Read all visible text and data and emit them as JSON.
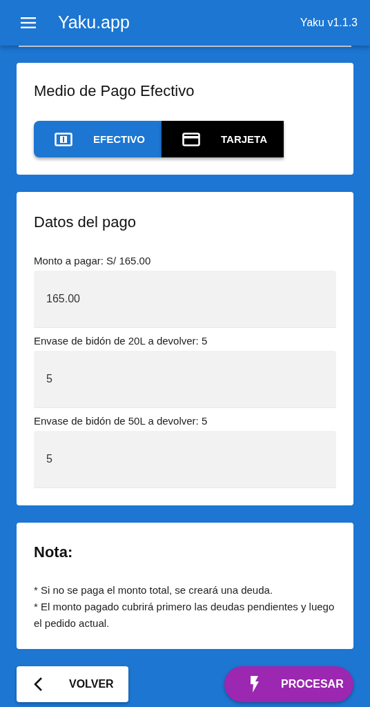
{
  "app_bar": {
    "title": "Yaku.app",
    "version": "Yaku v1.1.3"
  },
  "payment_method": {
    "title": "Medio de Pago Efectivo",
    "options": [
      {
        "label": "EFECTIVO",
        "kind": "cash",
        "selected": true
      },
      {
        "label": "TARJETA",
        "kind": "card",
        "selected": false
      }
    ]
  },
  "payment_data": {
    "title": "Datos del pago",
    "fields": [
      {
        "label": "Monto a pagar: S/ 165.00",
        "value": "165.00"
      },
      {
        "label": "Envase de bidón de 20L a devolver: 5",
        "value": "5"
      },
      {
        "label": "Envase de bidón de 50L a devolver: 5",
        "value": "5"
      }
    ]
  },
  "note": {
    "title": "Nota:",
    "lines": [
      "* Si no se paga el monto total, se creará una deuda.",
      "* El monto pagado cubrirá primero las deudas pendientes y luego el pedido actual."
    ]
  },
  "buttons": [
    {
      "label": "VOLVER",
      "kind": "back"
    },
    {
      "label": "PROCESAR",
      "kind": "process"
    }
  ]
}
